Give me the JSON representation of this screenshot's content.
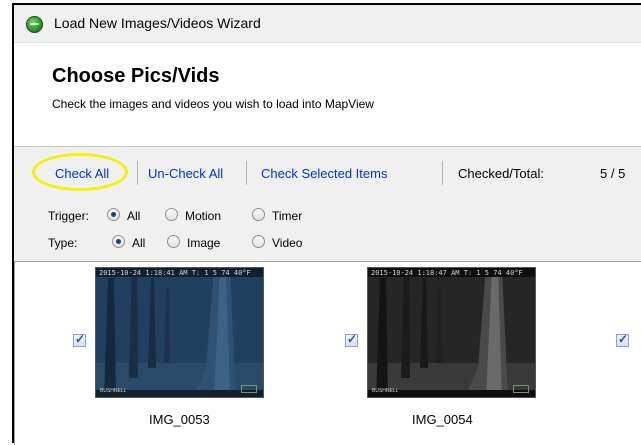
{
  "window": {
    "title": "Load New Images/Videos Wizard",
    "icon": "app-globe-icon"
  },
  "header": {
    "title": "Choose Pics/Vids",
    "subtitle": "Check the images and videos you wish to load into MapView"
  },
  "toolbar": {
    "check_all": "Check All",
    "uncheck_all": "Un-Check All",
    "check_selected": "Check Selected Items",
    "checked_total_label": "Checked/Total:",
    "checked_total_value": "5 / 5",
    "highlight_color": "#f5f000"
  },
  "filters": {
    "trigger": {
      "label": "Trigger:",
      "options": [
        "All",
        "Motion",
        "Timer"
      ],
      "selected": "All"
    },
    "type": {
      "label": "Type:",
      "options": [
        "All",
        "Image",
        "Video"
      ],
      "selected": "All"
    }
  },
  "thumbnails": [
    {
      "name": "IMG_0053",
      "checked": true,
      "tint": "blue",
      "stamp": "2015-10-24 1:18:41 AM   T: 1 5     74  40°F",
      "brand": "BUSHNELL"
    },
    {
      "name": "IMG_0054",
      "checked": true,
      "tint": "gray",
      "stamp": "2015-10-24 1:18:47 AM   T: 1 5     74  40°F",
      "brand": "BUSHNELL"
    },
    {
      "name": "",
      "checked": true
    }
  ],
  "colors": {
    "link": "#0033cc",
    "panel": "#f0f0f0"
  }
}
